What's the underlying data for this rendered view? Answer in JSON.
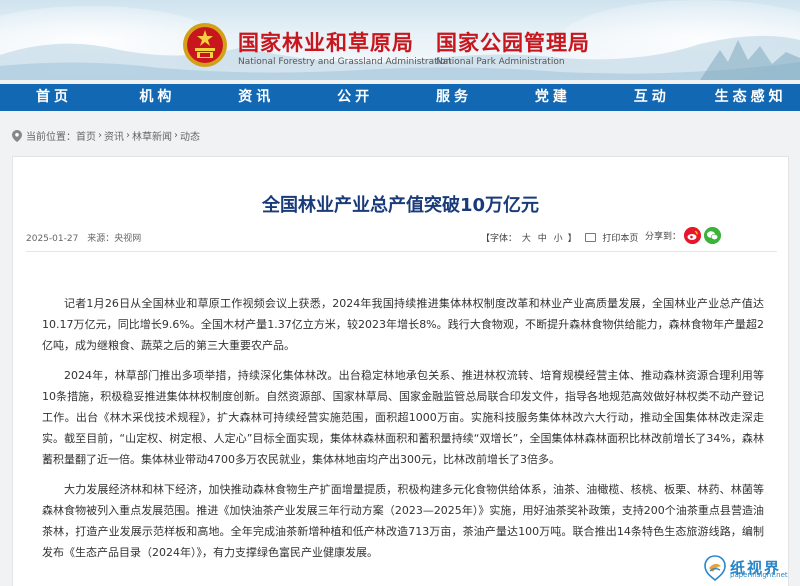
{
  "header": {
    "org1_cn": "国家林业和草原局",
    "org1_en": "National Forestry and Grassland Administration",
    "org2_cn": "国家公园管理局",
    "org2_en": "National Park Administration"
  },
  "nav": {
    "items": [
      "首页",
      "机构",
      "资讯",
      "公开",
      "服务",
      "党建",
      "互动",
      "生态感知"
    ]
  },
  "breadcrumb": {
    "label": "当前位置：",
    "items": [
      "首页",
      "资讯",
      "林草新闻",
      "动态"
    ],
    "separator": "›"
  },
  "article": {
    "title": "全国林业产业总产值突破10万亿元",
    "date": "2025-01-27",
    "source": "来源：央视网",
    "font_label": "【字体：",
    "font_sizes": [
      "大",
      "中",
      "小"
    ],
    "font_close": "】",
    "print_label": "打印本页",
    "share_label": "分享到：",
    "paragraphs": [
      "记者1月26日从全国林业和草原工作视频会议上获悉，2024年我国持续推进集体林权制度改革和林业产业高质量发展，全国林业产业总产值达10.17万亿元，同比增长9.6%。全国木材产量1.37亿立方米，较2023年增长8%。践行大食物观，不断提升森林食物供给能力，森林食物年产量超2亿吨，成为继粮食、蔬菜之后的第三大重要农产品。",
      "2024年，林草部门推出多项举措，持续深化集体林改。出台稳定林地承包关系、推进林权流转、培育规模经营主体、推动森林资源合理利用等10条措施，积极稳妥推进集体林权制度创新。自然资源部、国家林草局、国家金融监管总局联合印发文件，指导各地规范高效做好林权类不动产登记工作。出台《林木采伐技术规程》，扩大森林可持续经营实施范围，面积超1000万亩。实施科技服务集体林改六大行动，推动全国集体林改走深走实。截至目前，“山定权、树定根、人定心”目标全面实现，集体林森林面积和蓄积量持续“双增长”，全国集体林森林面积比林改前增长了34%，森林蓄积量翻了近一倍。集体林业带动4700多万农民就业，集体林地亩均产出300元，比林改前增长了3倍多。",
      "大力发展经济林和林下经济，加快推动森林食物生产扩面增量提质，积极构建多元化食物供给体系，油茶、油橄榄、核桃、板栗、林药、林菌等森林食物被列入重点发展范围。推进《加快油茶产业发展三年行动方案（2023—2025年）》实施，用好油茶奖补政策，支持200个油茶重点县营造油茶林，打造产业发展示范样板和高地。全年完成油茶新增种植和低产林改造713万亩，茶油产量达100万吨。联合推出14条特色生态旅游线路，编制发布《生态产品目录（2024年）》，有力支撑绿色富民产业健康发展。"
    ]
  },
  "watermark": {
    "text": "纸视界",
    "url": "paperinsight.net"
  },
  "colors": {
    "nav_bg": "#1268b3",
    "brand_red": "#c8161d",
    "title_blue": "#1a3b7a"
  }
}
